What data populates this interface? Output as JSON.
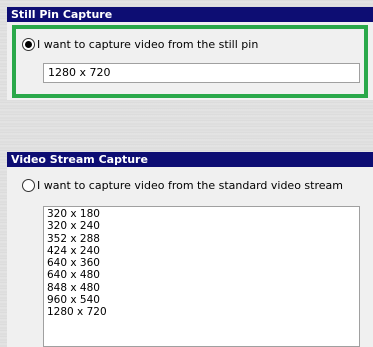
{
  "still_pin": {
    "header": "Still Pin Capture",
    "radio_label": "I want to capture video from the still pin",
    "radio_checked": true,
    "resolution_value": "1280 x 720",
    "highlight_color": "#2aa84a"
  },
  "video_stream": {
    "header": "Video Stream Capture",
    "radio_label": "I want to capture video from the standard video stream",
    "radio_checked": false,
    "resolutions": [
      "320 x 180",
      "320 x 240",
      "352 x 288",
      "424 x 240",
      "640 x 360",
      "640 x 480",
      "848 x 480",
      "960 x 540",
      "1280 x 720"
    ]
  },
  "colors": {
    "header_bg": "#0d0d73",
    "header_text": "#ffffff",
    "panel_bg": "#f0f0f0"
  }
}
